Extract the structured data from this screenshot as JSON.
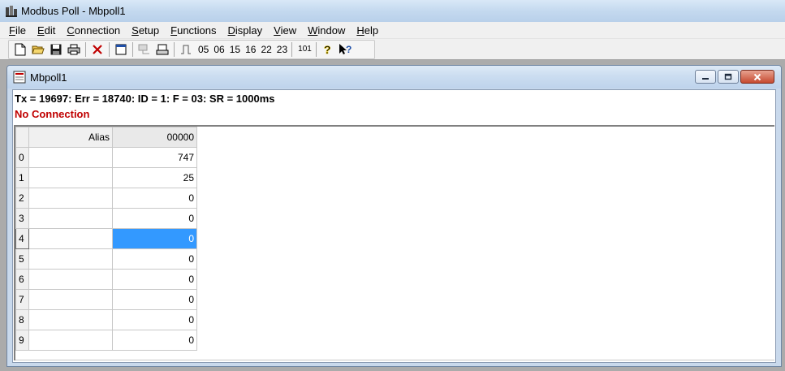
{
  "app": {
    "title": "Modbus Poll - Mbpoll1"
  },
  "menu": [
    {
      "first": "F",
      "rest": "ile"
    },
    {
      "first": "E",
      "rest": "dit"
    },
    {
      "first": "C",
      "rest": "onnection"
    },
    {
      "first": "S",
      "rest": "etup"
    },
    {
      "first": "F",
      "rest": "unctions"
    },
    {
      "first": "D",
      "rest": "isplay"
    },
    {
      "first": "V",
      "rest": "iew"
    },
    {
      "first": "W",
      "rest": "indow"
    },
    {
      "first": "H",
      "rest": "elp"
    }
  ],
  "toolbar": {
    "fc05": "05",
    "fc06": "06",
    "fc15": "15",
    "fc16": "16",
    "fc22": "22",
    "fc23": "23",
    "comm": "101"
  },
  "child": {
    "title": "Mbpoll1",
    "status_line": "Tx = 19697: Err = 18740: ID = 1: F = 03: SR = 1000ms",
    "connection_status": "No Connection",
    "colors": {
      "connection_status": "#c00000",
      "selection": "#3399ff"
    }
  },
  "grid": {
    "alias_header": "Alias",
    "value_header": "00000",
    "rows": [
      {
        "index": "0",
        "alias": "",
        "value": "747"
      },
      {
        "index": "1",
        "alias": "",
        "value": "25"
      },
      {
        "index": "2",
        "alias": "",
        "value": "0"
      },
      {
        "index": "3",
        "alias": "",
        "value": "0"
      },
      {
        "index": "4",
        "alias": "",
        "value": "0"
      },
      {
        "index": "5",
        "alias": "",
        "value": "0"
      },
      {
        "index": "6",
        "alias": "",
        "value": "0"
      },
      {
        "index": "7",
        "alias": "",
        "value": "0"
      },
      {
        "index": "8",
        "alias": "",
        "value": "0"
      },
      {
        "index": "9",
        "alias": "",
        "value": "0"
      }
    ],
    "selected_row": 4
  }
}
